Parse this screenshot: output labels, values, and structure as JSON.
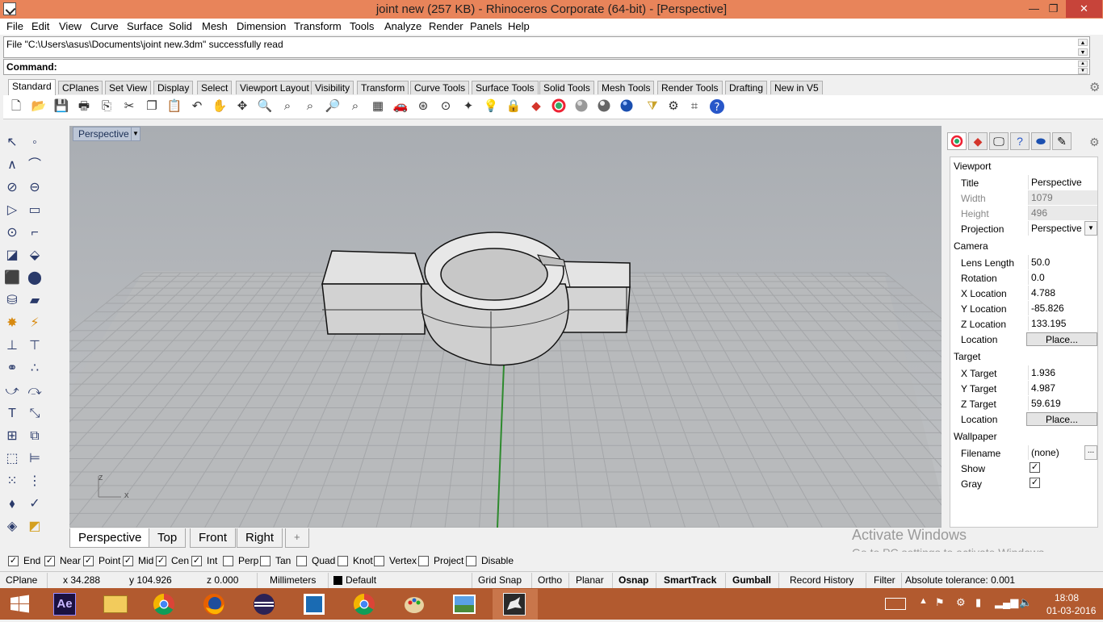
{
  "window": {
    "title": "joint new (257 KB) - Rhinoceros Corporate (64-bit) - [Perspective]",
    "minimize": "—",
    "maximize": "❐",
    "close": "✕"
  },
  "menu": [
    "File",
    "Edit",
    "View",
    "Curve",
    "Surface",
    "Solid",
    "Mesh",
    "Dimension",
    "Transform",
    "Tools",
    "Analyze",
    "Render",
    "Panels",
    "Help"
  ],
  "history": {
    "line": "File \"C:\\Users\\asus\\Documents\\joint new.3dm\" successfully read"
  },
  "command": {
    "label": "Command:"
  },
  "toolbar_tabs": [
    "Standard",
    "CPlanes",
    "Set View",
    "Display",
    "Select",
    "Viewport Layout",
    "Visibility",
    "Transform",
    "Curve Tools",
    "Surface Tools",
    "Solid Tools",
    "Mesh Tools",
    "Render Tools",
    "Drafting",
    "New in V5"
  ],
  "toolbar_icons": [
    "new-icon",
    "open-icon",
    "save-icon",
    "print-icon",
    "import-icon",
    "cut-icon",
    "copy-icon",
    "paste-icon",
    "undo-icon",
    "pan-icon",
    "rotate-view-icon",
    "zoom-icon",
    "zoom-window-icon",
    "zoom-extents-icon",
    "zoom-selected-icon",
    "zoom-dynamic-icon",
    "viewport-layout-icon",
    "car-render-icon",
    "osnap-icon",
    "cplane-icon",
    "light-icon",
    "lock-icon",
    "layer-icon",
    "color-icon",
    "shaded-icon",
    "rendered-icon",
    "sphere-icon",
    "filter-icon",
    "options-icon",
    "history-icon",
    "help-icon"
  ],
  "viewport": {
    "title": "Perspective",
    "axis_z": "z",
    "axis_x": "x"
  },
  "viewport_tabs": [
    "Perspective",
    "Top",
    "Front",
    "Right",
    "+"
  ],
  "panel": {
    "viewport_section": "Viewport",
    "title_label": "Title",
    "title_value": "Perspective",
    "width_label": "Width",
    "width_value": "1079",
    "height_label": "Height",
    "height_value": "496",
    "projection_label": "Projection",
    "projection_value": "Perspective",
    "camera_section": "Camera",
    "lens_label": "Lens Length",
    "lens_value": "50.0",
    "rotation_label": "Rotation",
    "rotation_value": "0.0",
    "xloc_label": "X Location",
    "xloc_value": "4.788",
    "yloc_label": "Y Location",
    "yloc_value": "-85.826",
    "zloc_label": "Z Location",
    "zloc_value": "133.195",
    "location_label": "Location",
    "place_button": "Place...",
    "target_section": "Target",
    "xt_label": "X Target",
    "xt_value": "1.936",
    "yt_label": "Y Target",
    "yt_value": "4.987",
    "zt_label": "Z Target",
    "zt_value": "59.619",
    "wallpaper_section": "Wallpaper",
    "filename_label": "Filename",
    "filename_value": "(none)",
    "browse_button": "...",
    "show_label": "Show",
    "gray_label": "Gray",
    "check": "✓"
  },
  "osnap": [
    {
      "label": "End",
      "checked": true
    },
    {
      "label": "Near",
      "checked": true
    },
    {
      "label": "Point",
      "checked": true
    },
    {
      "label": "Mid",
      "checked": true
    },
    {
      "label": "Cen",
      "checked": true
    },
    {
      "label": "Int",
      "checked": true
    },
    {
      "label": "Perp",
      "checked": false
    },
    {
      "label": "Tan",
      "checked": false
    },
    {
      "label": "Quad",
      "checked": false
    },
    {
      "label": "Knot",
      "checked": false
    },
    {
      "label": "Vertex",
      "checked": false
    },
    {
      "label": "Project",
      "checked": false
    },
    {
      "label": "Disable",
      "checked": false
    }
  ],
  "status": {
    "cplane": "CPlane",
    "x": "x 34.288",
    "y": "y 104.926",
    "z": "z 0.000",
    "units": "Millimeters",
    "layer": "Default",
    "grid_snap": "Grid Snap",
    "ortho": "Ortho",
    "planar": "Planar",
    "osnap": "Osnap",
    "smarttrack": "SmartTrack",
    "gumball": "Gumball",
    "record_history": "Record History",
    "filter": "Filter",
    "tolerance": "Absolute tolerance: 0.001"
  },
  "watermark": {
    "line1": "Activate Windows",
    "line2": "Go to PC settings to activate Windows."
  },
  "taskbar": {
    "time": "18:08",
    "date": "01-03-2016",
    "ae_label": "Ae"
  },
  "colors": {
    "titlebar": "#e8845a",
    "taskbar": "#b25a2f",
    "viewport_bg": "#b0b3b7"
  }
}
